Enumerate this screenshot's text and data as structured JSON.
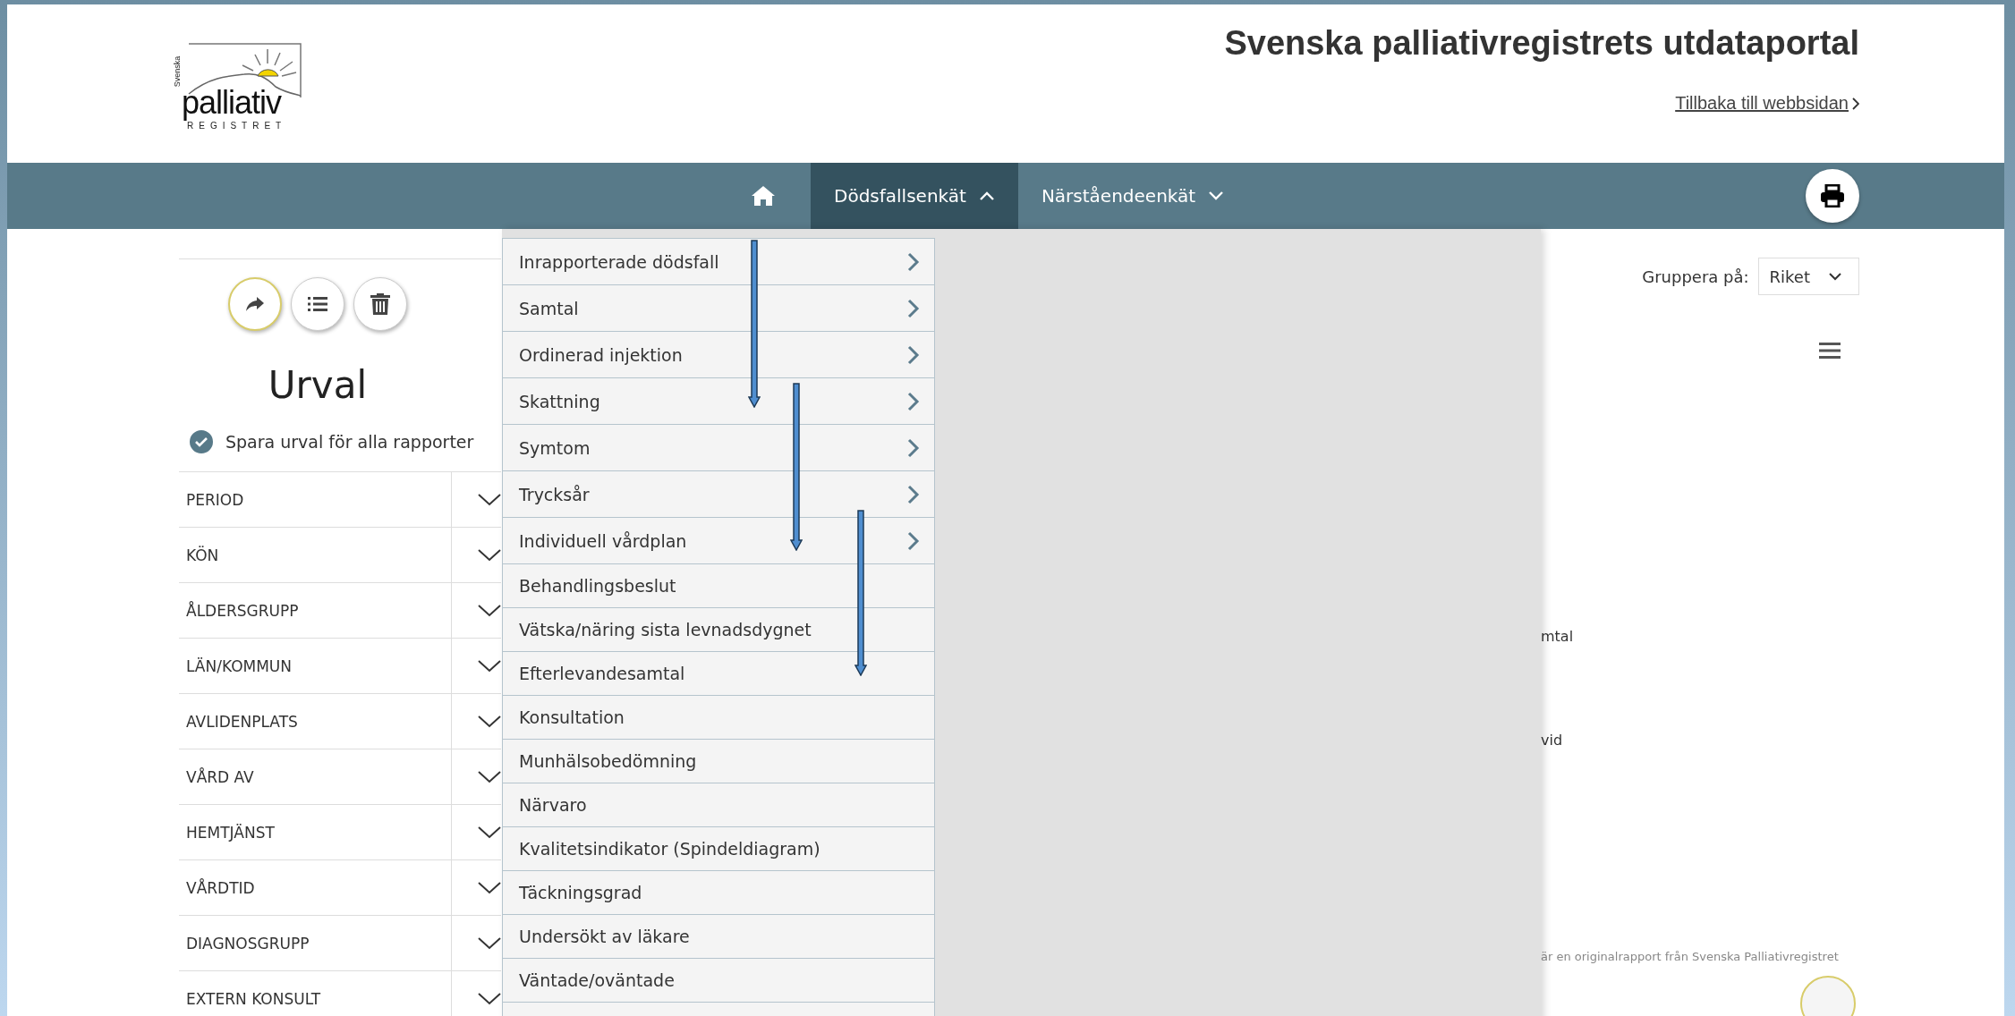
{
  "header": {
    "logo": {
      "side_text": "Svenska",
      "word": "palliativ",
      "sub_text": "REGISTRET"
    },
    "title": "Svenska palliativregistrets utdataportal",
    "back_link": "Tillbaka till webbsidan"
  },
  "nav": {
    "items": [
      {
        "kind": "home",
        "selected": false
      },
      {
        "kind": "menu",
        "label": "Dödsfallsenkät",
        "selected": true,
        "expanded": true
      },
      {
        "kind": "menu",
        "label": "Närståendeenkät",
        "selected": false,
        "expanded": false
      }
    ]
  },
  "dropdown": {
    "items": [
      {
        "label": "Inrapporterade dödsfall",
        "has_submenu": true
      },
      {
        "label": "Samtal",
        "has_submenu": true
      },
      {
        "label": "Ordinerad injektion",
        "has_submenu": true
      },
      {
        "label": "Skattning",
        "has_submenu": true
      },
      {
        "label": "Symtom",
        "has_submenu": true
      },
      {
        "label": "Trycksår",
        "has_submenu": true
      },
      {
        "label": "Individuell vårdplan",
        "has_submenu": true
      },
      {
        "label": "Behandlingsbeslut",
        "has_submenu": false
      },
      {
        "label": "Vätska/näring sista levnadsdygnet",
        "has_submenu": false
      },
      {
        "label": "Efterlevandesamtal",
        "has_submenu": false
      },
      {
        "label": "Konsultation",
        "has_submenu": false
      },
      {
        "label": "Munhälsobedömning",
        "has_submenu": false
      },
      {
        "label": "Närvaro",
        "has_submenu": false
      },
      {
        "label": "Kvalitetsindikator (Spindeldiagram)",
        "has_submenu": false
      },
      {
        "label": "Täckningsgrad",
        "has_submenu": false
      },
      {
        "label": "Undersökt av läkare",
        "has_submenu": false
      },
      {
        "label": "Väntade/oväntade",
        "has_submenu": false
      }
    ]
  },
  "sidebar": {
    "title": "Urval",
    "save_option": {
      "label": "Spara urval för alla rapporter",
      "checked": true
    },
    "filters": [
      "PERIOD",
      "KÖN",
      "ÅLDERSGRUPP",
      "LÄN/KOMMUN",
      "AVLIDENPLATS",
      "VÅRD AV",
      "HEMTJÄNST",
      "VÅRDTID",
      "DIAGNOSGRUPP",
      "EXTERN KONSULT"
    ]
  },
  "report": {
    "group_by": {
      "label": "Gruppera på:",
      "value": "Riket"
    },
    "fragments": [
      "mtal",
      "vid"
    ],
    "footer_note": "är en originalrapport från Svenska Palliativregistret"
  }
}
